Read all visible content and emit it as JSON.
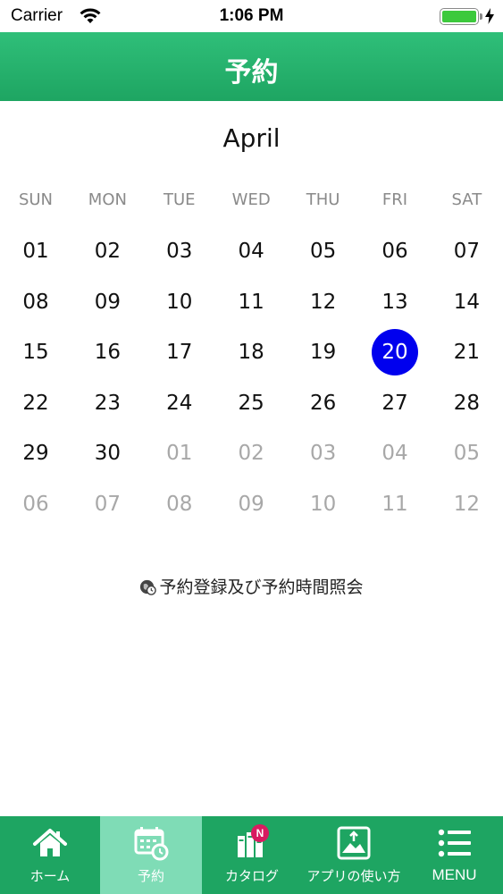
{
  "status_bar": {
    "carrier": "Carrier",
    "time": "1:06 PM",
    "battery_level": 1.0
  },
  "header": {
    "title": "予約"
  },
  "calendar": {
    "month": "April",
    "weekdays": [
      "SUN",
      "MON",
      "TUE",
      "WED",
      "THU",
      "FRI",
      "SAT"
    ],
    "weeks": [
      [
        {
          "d": "01"
        },
        {
          "d": "02"
        },
        {
          "d": "03"
        },
        {
          "d": "04"
        },
        {
          "d": "05"
        },
        {
          "d": "06"
        },
        {
          "d": "07"
        }
      ],
      [
        {
          "d": "08"
        },
        {
          "d": "09"
        },
        {
          "d": "10"
        },
        {
          "d": "11"
        },
        {
          "d": "12"
        },
        {
          "d": "13"
        },
        {
          "d": "14"
        }
      ],
      [
        {
          "d": "15"
        },
        {
          "d": "16"
        },
        {
          "d": "17"
        },
        {
          "d": "18"
        },
        {
          "d": "19"
        },
        {
          "d": "20",
          "selected": true
        },
        {
          "d": "21"
        }
      ],
      [
        {
          "d": "22"
        },
        {
          "d": "23"
        },
        {
          "d": "24"
        },
        {
          "d": "25"
        },
        {
          "d": "26"
        },
        {
          "d": "27"
        },
        {
          "d": "28"
        }
      ],
      [
        {
          "d": "29"
        },
        {
          "d": "30"
        },
        {
          "d": "01",
          "other": true
        },
        {
          "d": "02",
          "other": true
        },
        {
          "d": "03",
          "other": true
        },
        {
          "d": "04",
          "other": true
        },
        {
          "d": "05",
          "other": true
        }
      ],
      [
        {
          "d": "06",
          "other": true
        },
        {
          "d": "07",
          "other": true
        },
        {
          "d": "08",
          "other": true
        },
        {
          "d": "09",
          "other": true
        },
        {
          "d": "10",
          "other": true
        },
        {
          "d": "11",
          "other": true
        },
        {
          "d": "12",
          "other": true
        }
      ]
    ],
    "selected_color": "#0000ee"
  },
  "reserve_link": {
    "label": "予約登録及び予約時間照会",
    "icon": "globe-clock-icon"
  },
  "tab_bar": {
    "items": [
      {
        "label": "ホーム",
        "icon": "home-icon",
        "active": false
      },
      {
        "label": "予約",
        "icon": "calendar-clock-icon",
        "active": true
      },
      {
        "label": "カタログ",
        "icon": "books-icon",
        "active": false,
        "badge": "N"
      },
      {
        "label": "アプリの使い方",
        "icon": "picture-icon",
        "active": false
      },
      {
        "label": "MENU",
        "icon": "menu-list-icon",
        "active": false
      }
    ],
    "bg_color": "#1ea562",
    "active_color": "#7fdcb6"
  },
  "colors": {
    "brand": "#1ea562"
  }
}
